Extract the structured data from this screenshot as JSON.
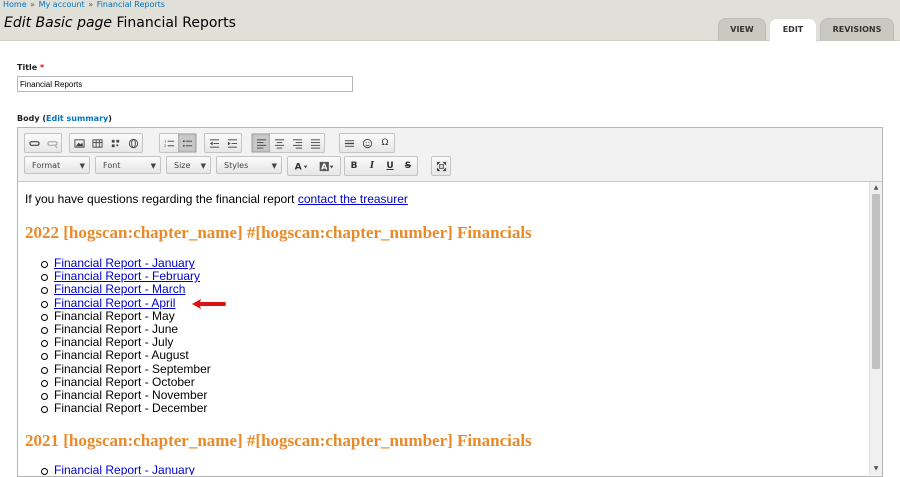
{
  "breadcrumb": {
    "home": "Home",
    "account": "My account",
    "current": "Financial Reports",
    "sep": "»"
  },
  "page": {
    "title_prefix": "Edit Basic page",
    "title_name": "Financial Reports"
  },
  "tabs": [
    {
      "label": "VIEW"
    },
    {
      "label": "EDIT"
    },
    {
      "label": "REVISIONS"
    }
  ],
  "title_field": {
    "label": "Title",
    "required_mark": "*",
    "value": "Financial Reports"
  },
  "body_field": {
    "label": "Body",
    "edit_summary": "Edit summary"
  },
  "toolbar": {
    "combos": [
      {
        "label": "Format"
      },
      {
        "label": "Font"
      },
      {
        "label": "Size"
      },
      {
        "label": "Styles"
      }
    ],
    "bold": "B",
    "italic": "I",
    "underline": "U",
    "strike": "S",
    "special_char": "Ω"
  },
  "content": {
    "intro_text": "If you have questions regarding the financial report ",
    "intro_link": "contact the treasurer",
    "heading_2022": "2022 [hogscan:chapter_name] #[hogscan:chapter_number] Financials",
    "reports_2022": [
      {
        "label": "Financial Report - January",
        "linked": true
      },
      {
        "label": "Financial Report - February",
        "linked": true
      },
      {
        "label": "Financial Report - March",
        "linked": true
      },
      {
        "label": "Financial Report - April",
        "linked": true
      },
      {
        "label": "Financial Report - May",
        "linked": false
      },
      {
        "label": "Financial Report - June",
        "linked": false
      },
      {
        "label": "Financial Report - July",
        "linked": false
      },
      {
        "label": "Financial Report - August",
        "linked": false
      },
      {
        "label": "Financial Report - September",
        "linked": false
      },
      {
        "label": "Financial Report - October",
        "linked": false
      },
      {
        "label": "Financial Report - November",
        "linked": false
      },
      {
        "label": "Financial Report - December",
        "linked": false
      }
    ],
    "heading_2021": "2021 [hogscan:chapter_name] #[hogscan:chapter_number] Financials",
    "reports_2021": [
      {
        "label": "Financial Report - January",
        "linked": true
      }
    ]
  },
  "colors": {
    "heading": "#e88a2a",
    "link": "#0000cc",
    "annotation_arrow": "#dd1111"
  }
}
